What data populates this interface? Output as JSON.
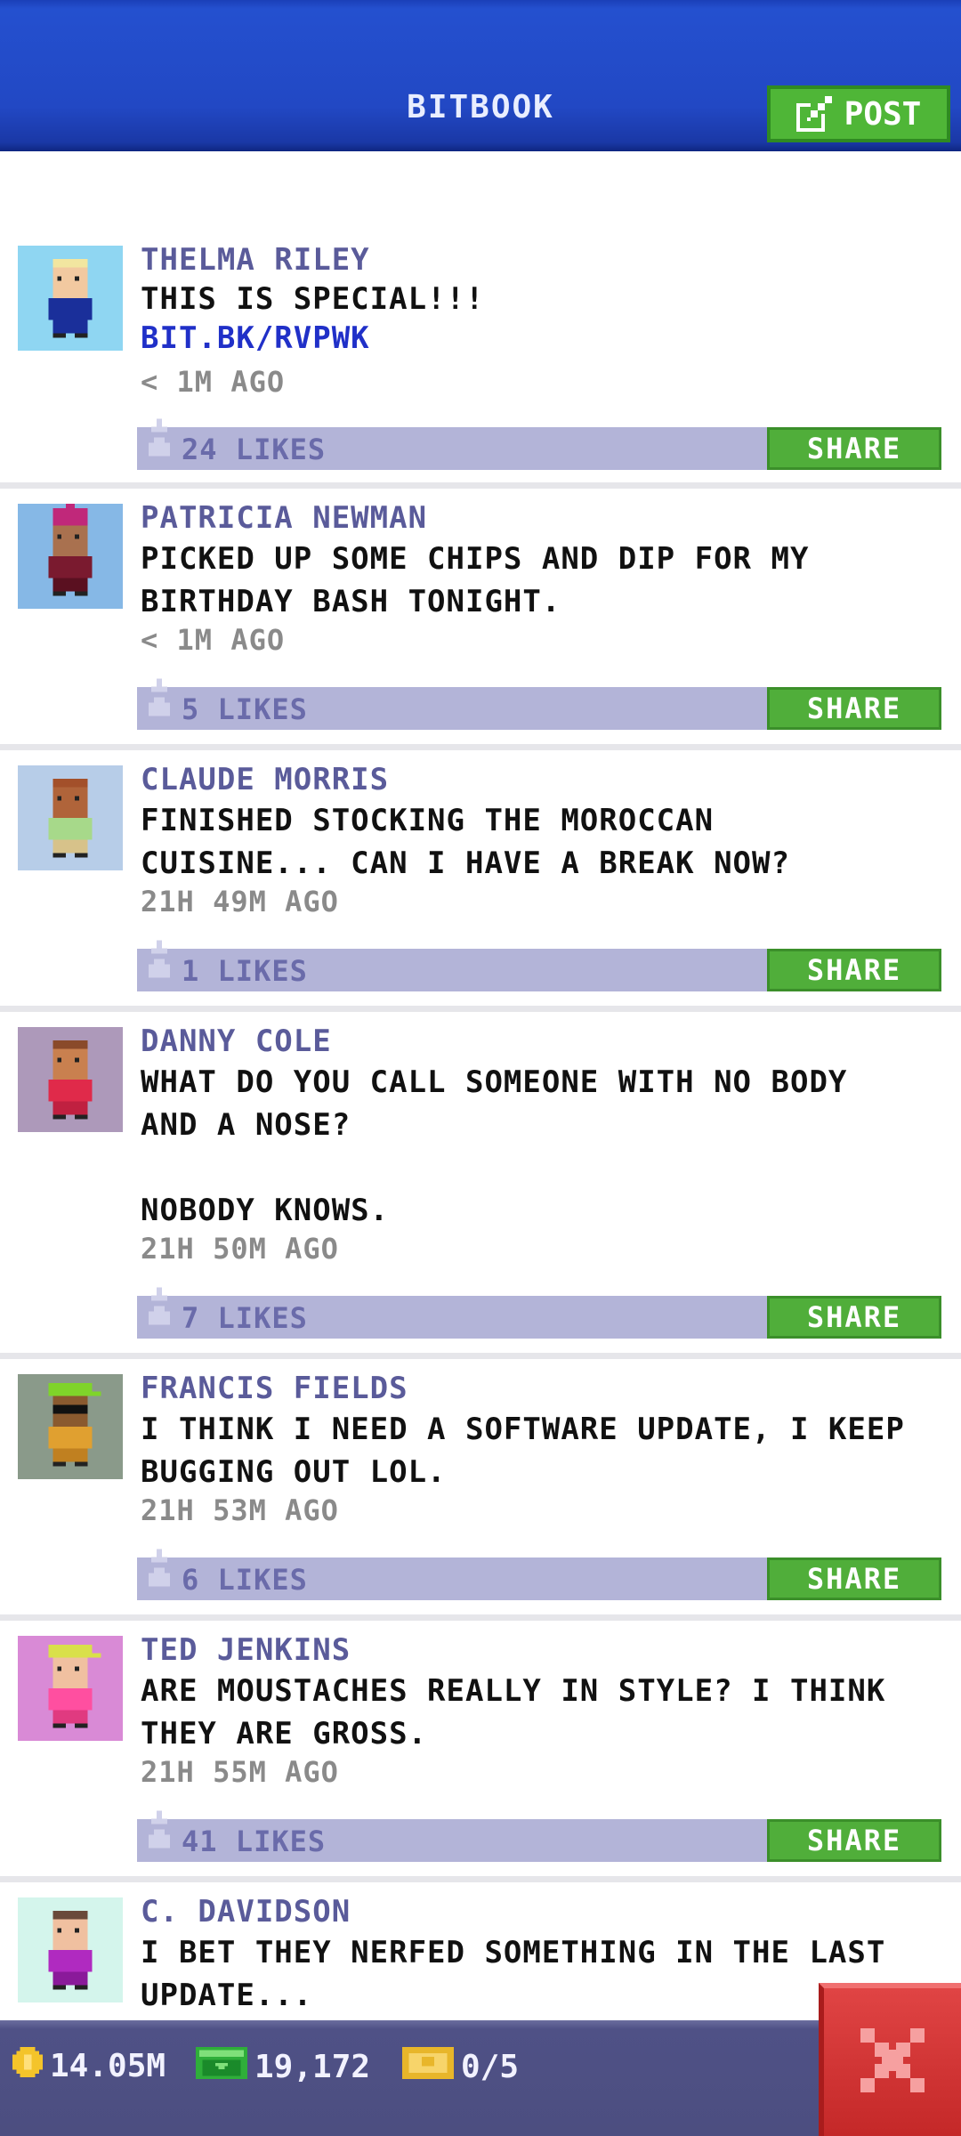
{
  "header": {
    "title": "BITBOOK",
    "post_label": "POST"
  },
  "share_label": "SHARE",
  "posts": [
    {
      "author": "THELMA RILEY",
      "text": "THIS IS SPECIAL!!!",
      "link": "BIT.BK/RVPWK",
      "time": "< 1M AGO",
      "likes": "24 LIKES",
      "avatar_bg": "#8fd6f2"
    },
    {
      "author": "PATRICIA NEWMAN",
      "text": "PICKED UP SOME CHIPS AND DIP FOR MY\nBIRTHDAY BASH TONIGHT.",
      "time": "< 1M AGO",
      "likes": "5 LIKES",
      "avatar_bg": "#86b8e6"
    },
    {
      "author": "CLAUDE MORRIS",
      "text": "FINISHED STOCKING THE MOROCCAN\nCUISINE... CAN I HAVE A BREAK NOW?",
      "time": "21H 49M AGO",
      "likes": "1 LIKES",
      "avatar_bg": "#b7cde8"
    },
    {
      "author": "DANNY COLE",
      "text": "WHAT DO YOU CALL SOMEONE WITH NO BODY\nAND A NOSE?\n\nNOBODY KNOWS.",
      "time": "21H 50M AGO",
      "likes": "7 LIKES",
      "avatar_bg": "#ad99ba"
    },
    {
      "author": "FRANCIS FIELDS",
      "text": "I THINK I NEED A SOFTWARE UPDATE, I KEEP\nBUGGING OUT LOL.",
      "time": "21H 53M AGO",
      "likes": "6 LIKES",
      "avatar_bg": "#8a9a8a"
    },
    {
      "author": "TED JENKINS",
      "text": "ARE MOUSTACHES REALLY IN STYLE? I THINK\nTHEY ARE GROSS.",
      "time": "21H 55M AGO",
      "likes": "41 LIKES",
      "avatar_bg": "#d98ad6"
    },
    {
      "author": "C. DAVIDSON",
      "text": "I BET THEY NERFED SOMETHING IN THE LAST\nUPDATE...",
      "avatar_bg": "#d4f5ec"
    }
  ],
  "status": {
    "coins": "14.05M",
    "bux": "19,172",
    "tickets": "0/5"
  }
}
